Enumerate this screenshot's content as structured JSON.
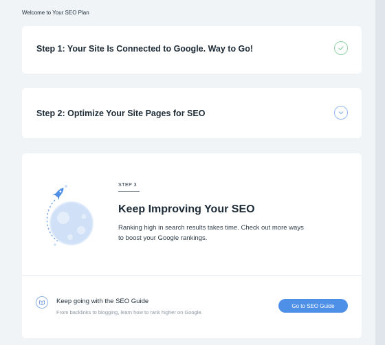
{
  "header": {
    "title": "Welcome to Your SEO Plan"
  },
  "steps": [
    {
      "title": "Step 1: Your Site Is Connected to Google. Way to Go!",
      "status_icon": "check-icon",
      "status_color": "#8fd3a8"
    },
    {
      "title": "Step 2: Optimize Your Site Pages for SEO",
      "status_icon": "chevron-down-icon",
      "status_color": "#8fb8f0"
    }
  ],
  "step3": {
    "label": "STEP 3",
    "title": "Keep Improving Your SEO",
    "description": "Ranking high in search results takes time. Check out more ways to boost your Google rankings.",
    "illustration": "rocket-planet-icon"
  },
  "guide": {
    "icon": "book-icon",
    "title": "Keep going with the SEO Guide",
    "subtitle": "From backlinks to blogging, learn how to rank higher on Google.",
    "button_label": "Go to SEO Guide",
    "button_color": "#4e8fe8"
  }
}
